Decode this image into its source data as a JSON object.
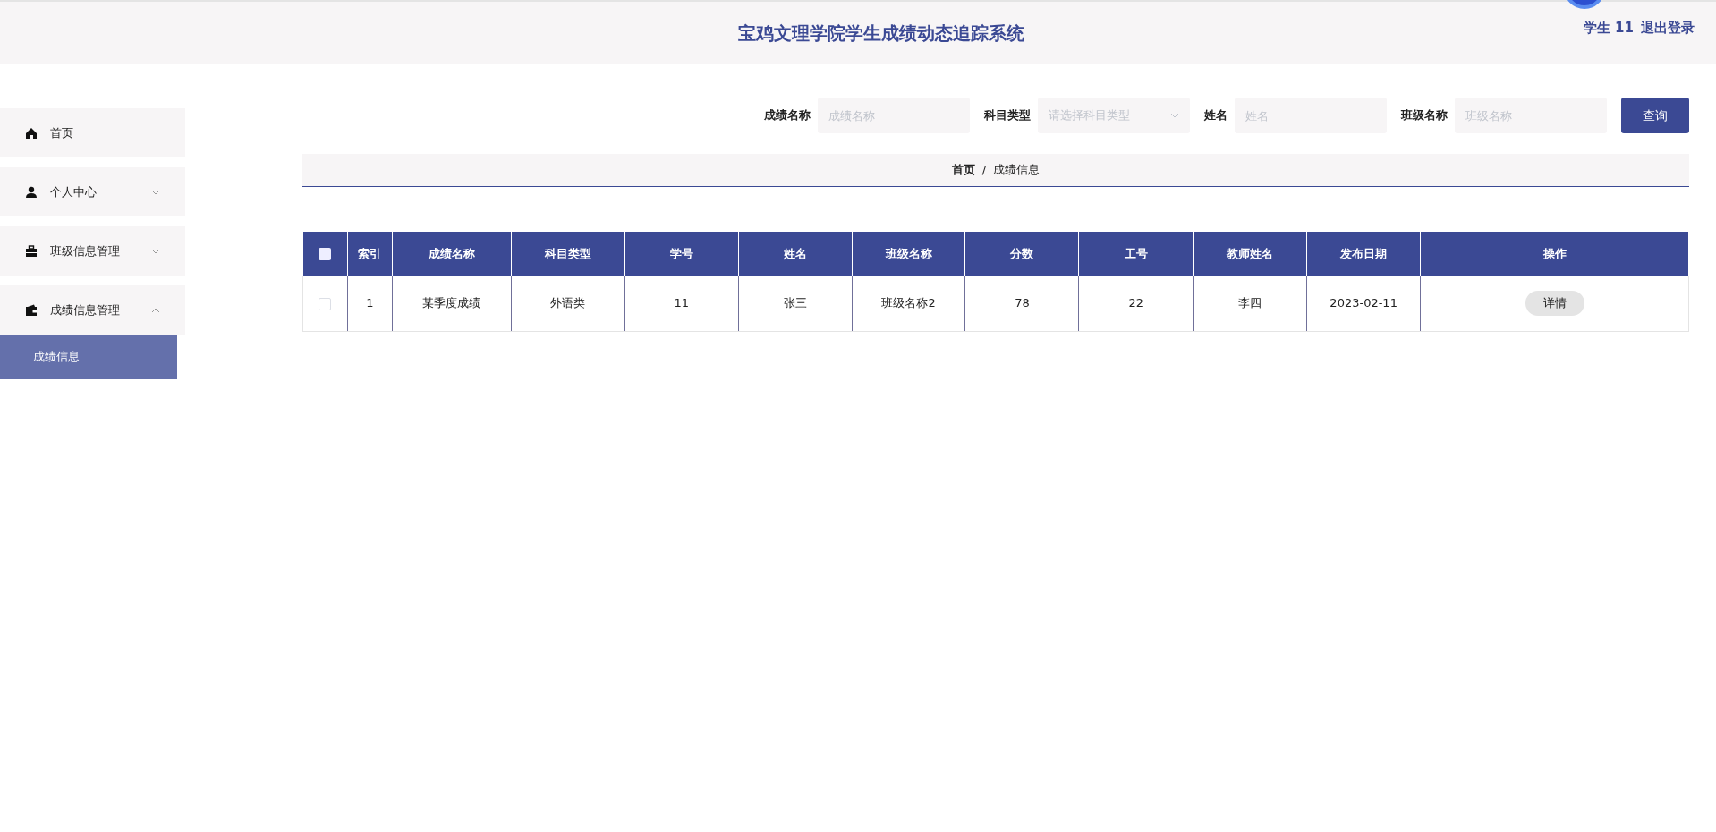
{
  "header": {
    "title": "宝鸡文理学院学生成绩动态追踪系统",
    "user": "学生 11",
    "logout": "退出登录"
  },
  "sidebar": {
    "items": [
      {
        "kind": "home",
        "label": "首页"
      },
      {
        "kind": "person",
        "label": "个人中心",
        "expanded": false
      },
      {
        "kind": "briefcase",
        "label": "班级信息管理",
        "expanded": false
      },
      {
        "kind": "wallet",
        "label": "成绩信息管理",
        "expanded": true,
        "children": [
          {
            "label": "成绩信息",
            "selected": true
          }
        ]
      }
    ]
  },
  "search": {
    "fields": [
      {
        "kind": "input",
        "label": "成绩名称",
        "placeholder": "成绩名称"
      },
      {
        "kind": "select",
        "label": "科目类型",
        "placeholder": "请选择科目类型"
      },
      {
        "kind": "input",
        "label": "姓名",
        "placeholder": "姓名"
      },
      {
        "kind": "input",
        "label": "班级名称",
        "placeholder": "班级名称"
      }
    ],
    "button": "查询"
  },
  "breadcrumb": {
    "separator": "/",
    "items": [
      "首页",
      "成绩信息"
    ]
  },
  "table": {
    "select_all_checked": false,
    "columns": [
      "索引",
      "成绩名称",
      "科目类型",
      "学号",
      "姓名",
      "班级名称",
      "分数",
      "工号",
      "教师姓名",
      "发布日期",
      "操作"
    ],
    "rows": [
      {
        "checked": false,
        "cells": [
          "1",
          "某季度成绩",
          "外语类",
          "11",
          "张三",
          "班级名称2",
          "78",
          "22",
          "李四",
          "2023-02-11"
        ],
        "action": "详情"
      }
    ]
  }
}
